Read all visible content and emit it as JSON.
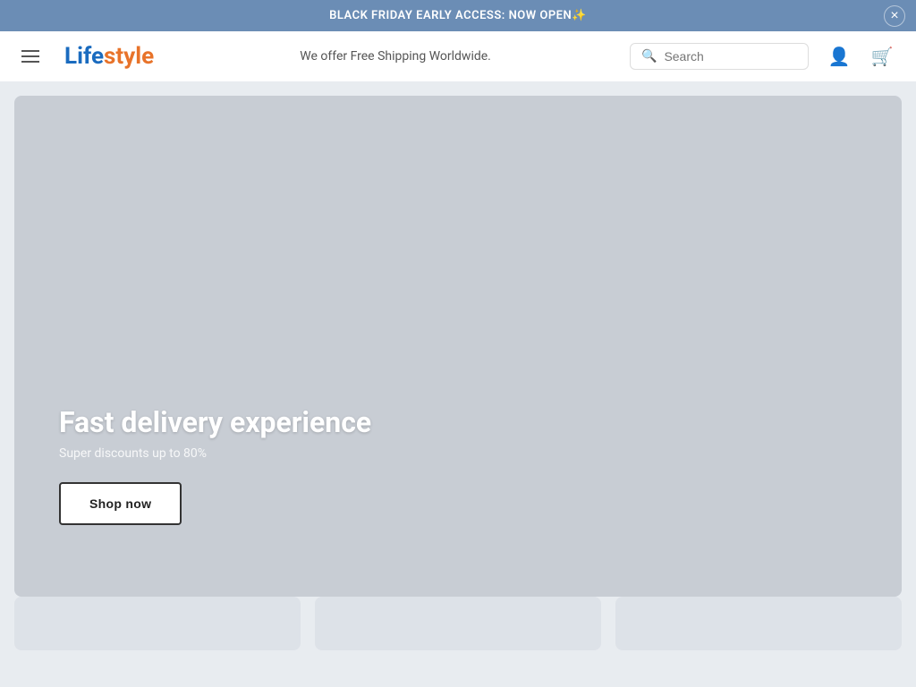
{
  "announcement": {
    "text": "BLACK FRIDAY EARLY ACCESS: NOW OPEN✨",
    "close_label": "×"
  },
  "header": {
    "menu_label": "Menu",
    "logo_life": "Life",
    "logo_style": "style",
    "tagline": "We offer Free Shipping Worldwide.",
    "search_placeholder": "Search",
    "account_icon": "👤",
    "cart_icon": "🛒"
  },
  "hero": {
    "title": "Fast delivery experience",
    "subtitle": "Super discounts up to 80%",
    "cta_label": "Shop now"
  },
  "colors": {
    "banner_bg": "#6b8db5",
    "logo_blue": "#1a6bbf",
    "logo_orange": "#e8732a",
    "hero_bg": "#c8cdd4"
  }
}
